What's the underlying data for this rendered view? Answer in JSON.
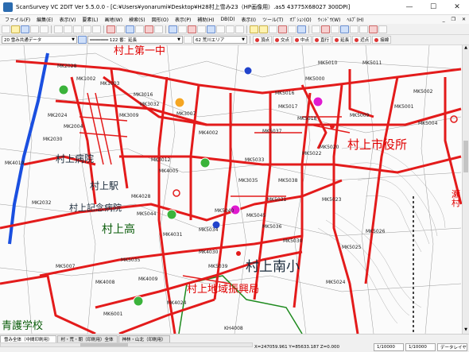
{
  "window": {
    "title": "ScanSurvey VC 2DIT  Ver 5.5.0.0 - [C:¥Users¥yonarumi¥Desktop¥H28村上雪み23（HP画像用）.as5  43775X68027 300DPI]",
    "minimize": "—",
    "maximize": "☐",
    "close": "✕"
  },
  "menu": {
    "items": [
      "ファイル(F)",
      "編集(E)",
      "表示(V)",
      "要素(L)",
      "画地(W)",
      "検索(S)",
      "図形(O)",
      "表示(P)",
      "補助(H)",
      "DB(D)",
      "表示(I)",
      "ツール(T)",
      "ｵﾌﾟｼｮﾝ(O)",
      "ｳｨﾝﾄﾞｳ(W)",
      "ﾍﾙﾌﾟ(H)"
    ],
    "mdi_min": "_",
    "mdi_restore": "❐",
    "mdi_close": "✕"
  },
  "toolbar2": {
    "layer_combo": "20  雪み共通データ",
    "line_combo": "━━━━━━━  122 番：延長",
    "color_combo": "62 荒川エリア",
    "snap_buttons": [
      "頂点",
      "交点",
      "中点",
      "直行",
      "延長",
      "近点",
      "接線"
    ]
  },
  "map": {
    "labels": [
      {
        "text": "村上第一中",
        "size": 13
      },
      {
        "text": "村上市役所",
        "size": 15
      },
      {
        "text": "村上病院",
        "size": 12
      },
      {
        "text": "村上駅",
        "size": 12
      },
      {
        "text": "村上記念病院",
        "size": 11
      },
      {
        "text": "村上高",
        "size": 14
      },
      {
        "text": "村上南小",
        "size": 17
      },
      {
        "text": "村上地域振興局",
        "size": 13
      },
      {
        "text": "青護学校",
        "size": 13
      },
      {
        "text": "瀬\n村",
        "size": 11
      }
    ],
    "road_codes": [
      "MK2028",
      "MK1002",
      "MK1003",
      "MK2024",
      "MK4019",
      "MK2030",
      "MK2004",
      "MK2032",
      "MK3016",
      "MK3032",
      "MK3009",
      "MK3007",
      "MK3035",
      "MK3012",
      "MK4002",
      "MK4005",
      "MK4028",
      "MK5000",
      "MK5010",
      "MK5011",
      "MK5016",
      "MK5017",
      "MK5018",
      "MK5001",
      "MK5009",
      "MK5020",
      "MK5022",
      "MK5033",
      "MK5037",
      "MK5038",
      "MK5040",
      "MK5045",
      "MK5036",
      "MK5031",
      "MK4030",
      "MK4031",
      "MK5034",
      "MK5035",
      "MK5039",
      "MK4008",
      "MK4009",
      "MK5007",
      "MK6001",
      "MK4024",
      "MK5002",
      "MK5004",
      "MK5026",
      "MK5024",
      "KH4008",
      "MK5025",
      "MK5023",
      "MK5044",
      "MK5030"
    ]
  },
  "statusbar": {
    "tabs": [
      "雪み全体（中間印刷用）",
      "村・荒・朝（印刷用）全体",
      "神林・山北（印刷用）"
    ],
    "coords": "X=247059.961  Y=85633.187  Z=0.000",
    "scale1": "1/10000",
    "scale2": "1/10000",
    "mode": "データレイヤ"
  }
}
